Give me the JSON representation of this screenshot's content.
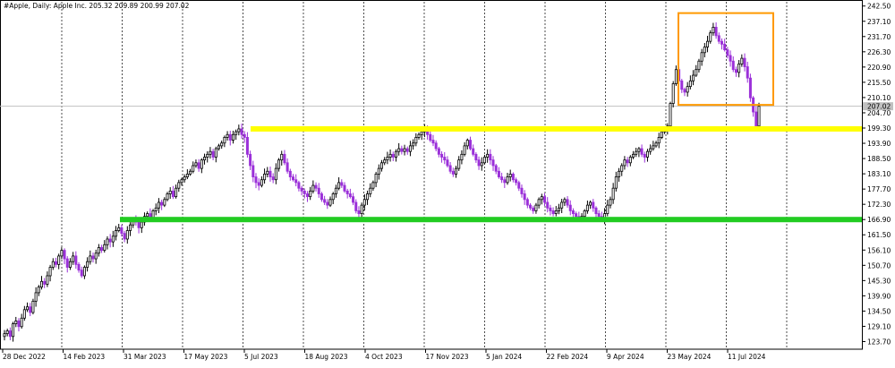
{
  "header": {
    "symbol_line": "#Apple, Daily:  Apple Inc.  205.32 209.89 200.99 207.02"
  },
  "colors": {
    "background": "#ffffff",
    "grid": "#000000",
    "bull_candle": "#000000",
    "bear_candle": "#9b30d9",
    "support_line": "#22cc22",
    "resistance_line": "#ffff00",
    "highlight_box": "#ff9900",
    "price_marker": "#c0c0c0"
  },
  "chart_data": {
    "type": "candlestick",
    "title": "#Apple, Daily:  Apple Inc.  205.32 209.89 200.99 207.02",
    "last_price": "207.02",
    "y_ticks": [
      "242.50",
      "237.10",
      "231.70",
      "226.30",
      "220.90",
      "215.50",
      "210.10",
      "204.70",
      "199.30",
      "193.90",
      "188.50",
      "183.10",
      "177.70",
      "172.30",
      "166.90",
      "161.50",
      "156.10",
      "150.70",
      "145.30",
      "139.90",
      "134.50",
      "129.10",
      "123.70"
    ],
    "ylim": [
      121.0,
      244.0
    ],
    "x_labels": [
      "28 Dec 2022",
      "14 Feb 2023",
      "31 Mar 2023",
      "17 May 2023",
      "5 Jul 2023",
      "18 Aug 2023",
      "4 Oct 2023",
      "17 Nov 2023",
      "5 Jan 2024",
      "22 Feb 2024",
      "9 Apr 2024",
      "23 May 2024",
      "11 Jul 2024"
    ],
    "support_level": 166.9,
    "resistance_level": 199.0,
    "highlight_box": {
      "price_top": 240.0,
      "price_bottom": 207.5
    },
    "series": [
      {
        "values": [
          126.5,
          127.5,
          125.5,
          130,
          131,
          129,
          132,
          135,
          136,
          134,
          138,
          141,
          143,
          145,
          144,
          147,
          150,
          152,
          151,
          154,
          156,
          153,
          150,
          152,
          154,
          151,
          149,
          147,
          150,
          152,
          154,
          153,
          155,
          157,
          156,
          158,
          160,
          159,
          161,
          163,
          164,
          162,
          160,
          163,
          165,
          167,
          166,
          164,
          166,
          168,
          169,
          167,
          170,
          171,
          173,
          172,
          174,
          176,
          177,
          175,
          178,
          180,
          181,
          182,
          183,
          184,
          186,
          187,
          185,
          188,
          189,
          190,
          191,
          189,
          192,
          193,
          194,
          196,
          197,
          195,
          197,
          198,
          199,
          197,
          196,
          190,
          186,
          182,
          180,
          179,
          181,
          183,
          184,
          182,
          181,
          185,
          188,
          190,
          187,
          184,
          182,
          181,
          180,
          178,
          177,
          176,
          175,
          177,
          179,
          178,
          176,
          174,
          173,
          172,
          174,
          176,
          178,
          180,
          179,
          177,
          176,
          175,
          173,
          170,
          169,
          172,
          174,
          176,
          178,
          180,
          183,
          185,
          187,
          188,
          189,
          190,
          189,
          191,
          192,
          191,
          192,
          191,
          193,
          194,
          196,
          197,
          198,
          199,
          197,
          195,
          194,
          192,
          190,
          189,
          188,
          186,
          184,
          183,
          185,
          188,
          190,
          193,
          195,
          192,
          190,
          188,
          186,
          187,
          189,
          190,
          188,
          186,
          184,
          182,
          181,
          180,
          182,
          183,
          181,
          180,
          178,
          176,
          174,
          172,
          171,
          170,
          172,
          174,
          175,
          173,
          171,
          170,
          169,
          170,
          171,
          173,
          174,
          172,
          170,
          169,
          168,
          167,
          168,
          170,
          172,
          173,
          171,
          169,
          168,
          167,
          169,
          172,
          174,
          178,
          182,
          184,
          186,
          188,
          187,
          189,
          190,
          191,
          192,
          190,
          189,
          191,
          192,
          193,
          194,
          196,
          198,
          199,
          200,
          208,
          215,
          220,
          216,
          213,
          212,
          214,
          216,
          218,
          220,
          223,
          226,
          228,
          230,
          233,
          235,
          232,
          230,
          229,
          227,
          225,
          223,
          220,
          219,
          222,
          224,
          221,
          217,
          210,
          205,
          200,
          207
        ]
      }
    ]
  }
}
